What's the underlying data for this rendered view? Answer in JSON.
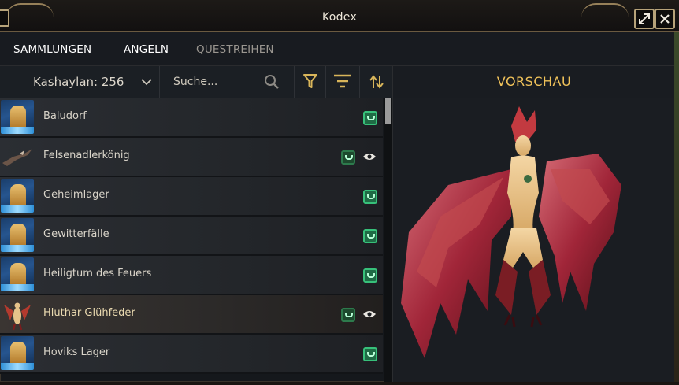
{
  "window": {
    "title": "Kodex",
    "maximize_icon": "resize-icon",
    "close_icon": "close-icon"
  },
  "tabs": [
    {
      "label": "SAMMLUNGEN",
      "active": true
    },
    {
      "label": "ANGELN",
      "active": false
    },
    {
      "label": "QUESTREIHEN",
      "active": false
    }
  ],
  "toolbar": {
    "category_label": "Kashaylan: 256",
    "search_placeholder": "Suche...",
    "icons": [
      "search-icon",
      "filter-icon",
      "sort-lines-icon",
      "sort-arrows-icon"
    ]
  },
  "list": {
    "items": [
      {
        "label": "Baludorf",
        "thumb": "location",
        "has_eye": false,
        "highlight": false
      },
      {
        "label": "Felsenadlerkönig",
        "thumb": "creature",
        "has_eye": true,
        "highlight": false
      },
      {
        "label": "Geheimlager",
        "thumb": "location",
        "has_eye": false,
        "highlight": false
      },
      {
        "label": "Gewitterfälle",
        "thumb": "location",
        "has_eye": false,
        "highlight": false
      },
      {
        "label": "Heiligtum des Feuers",
        "thumb": "location",
        "has_eye": false,
        "highlight": false
      },
      {
        "label": "Hluthar Glühfeder",
        "thumb": "creature",
        "has_eye": true,
        "highlight": true
      },
      {
        "label": "Hoviks Lager",
        "thumb": "location",
        "has_eye": false,
        "highlight": false
      }
    ]
  },
  "preview": {
    "title": "VORSCHAU",
    "subject": "red-feathered-harpy-figure"
  },
  "colors": {
    "accent_gold": "#f0c25a",
    "badge_green": "#37c07a",
    "frame_gold": "#b7a37a"
  }
}
